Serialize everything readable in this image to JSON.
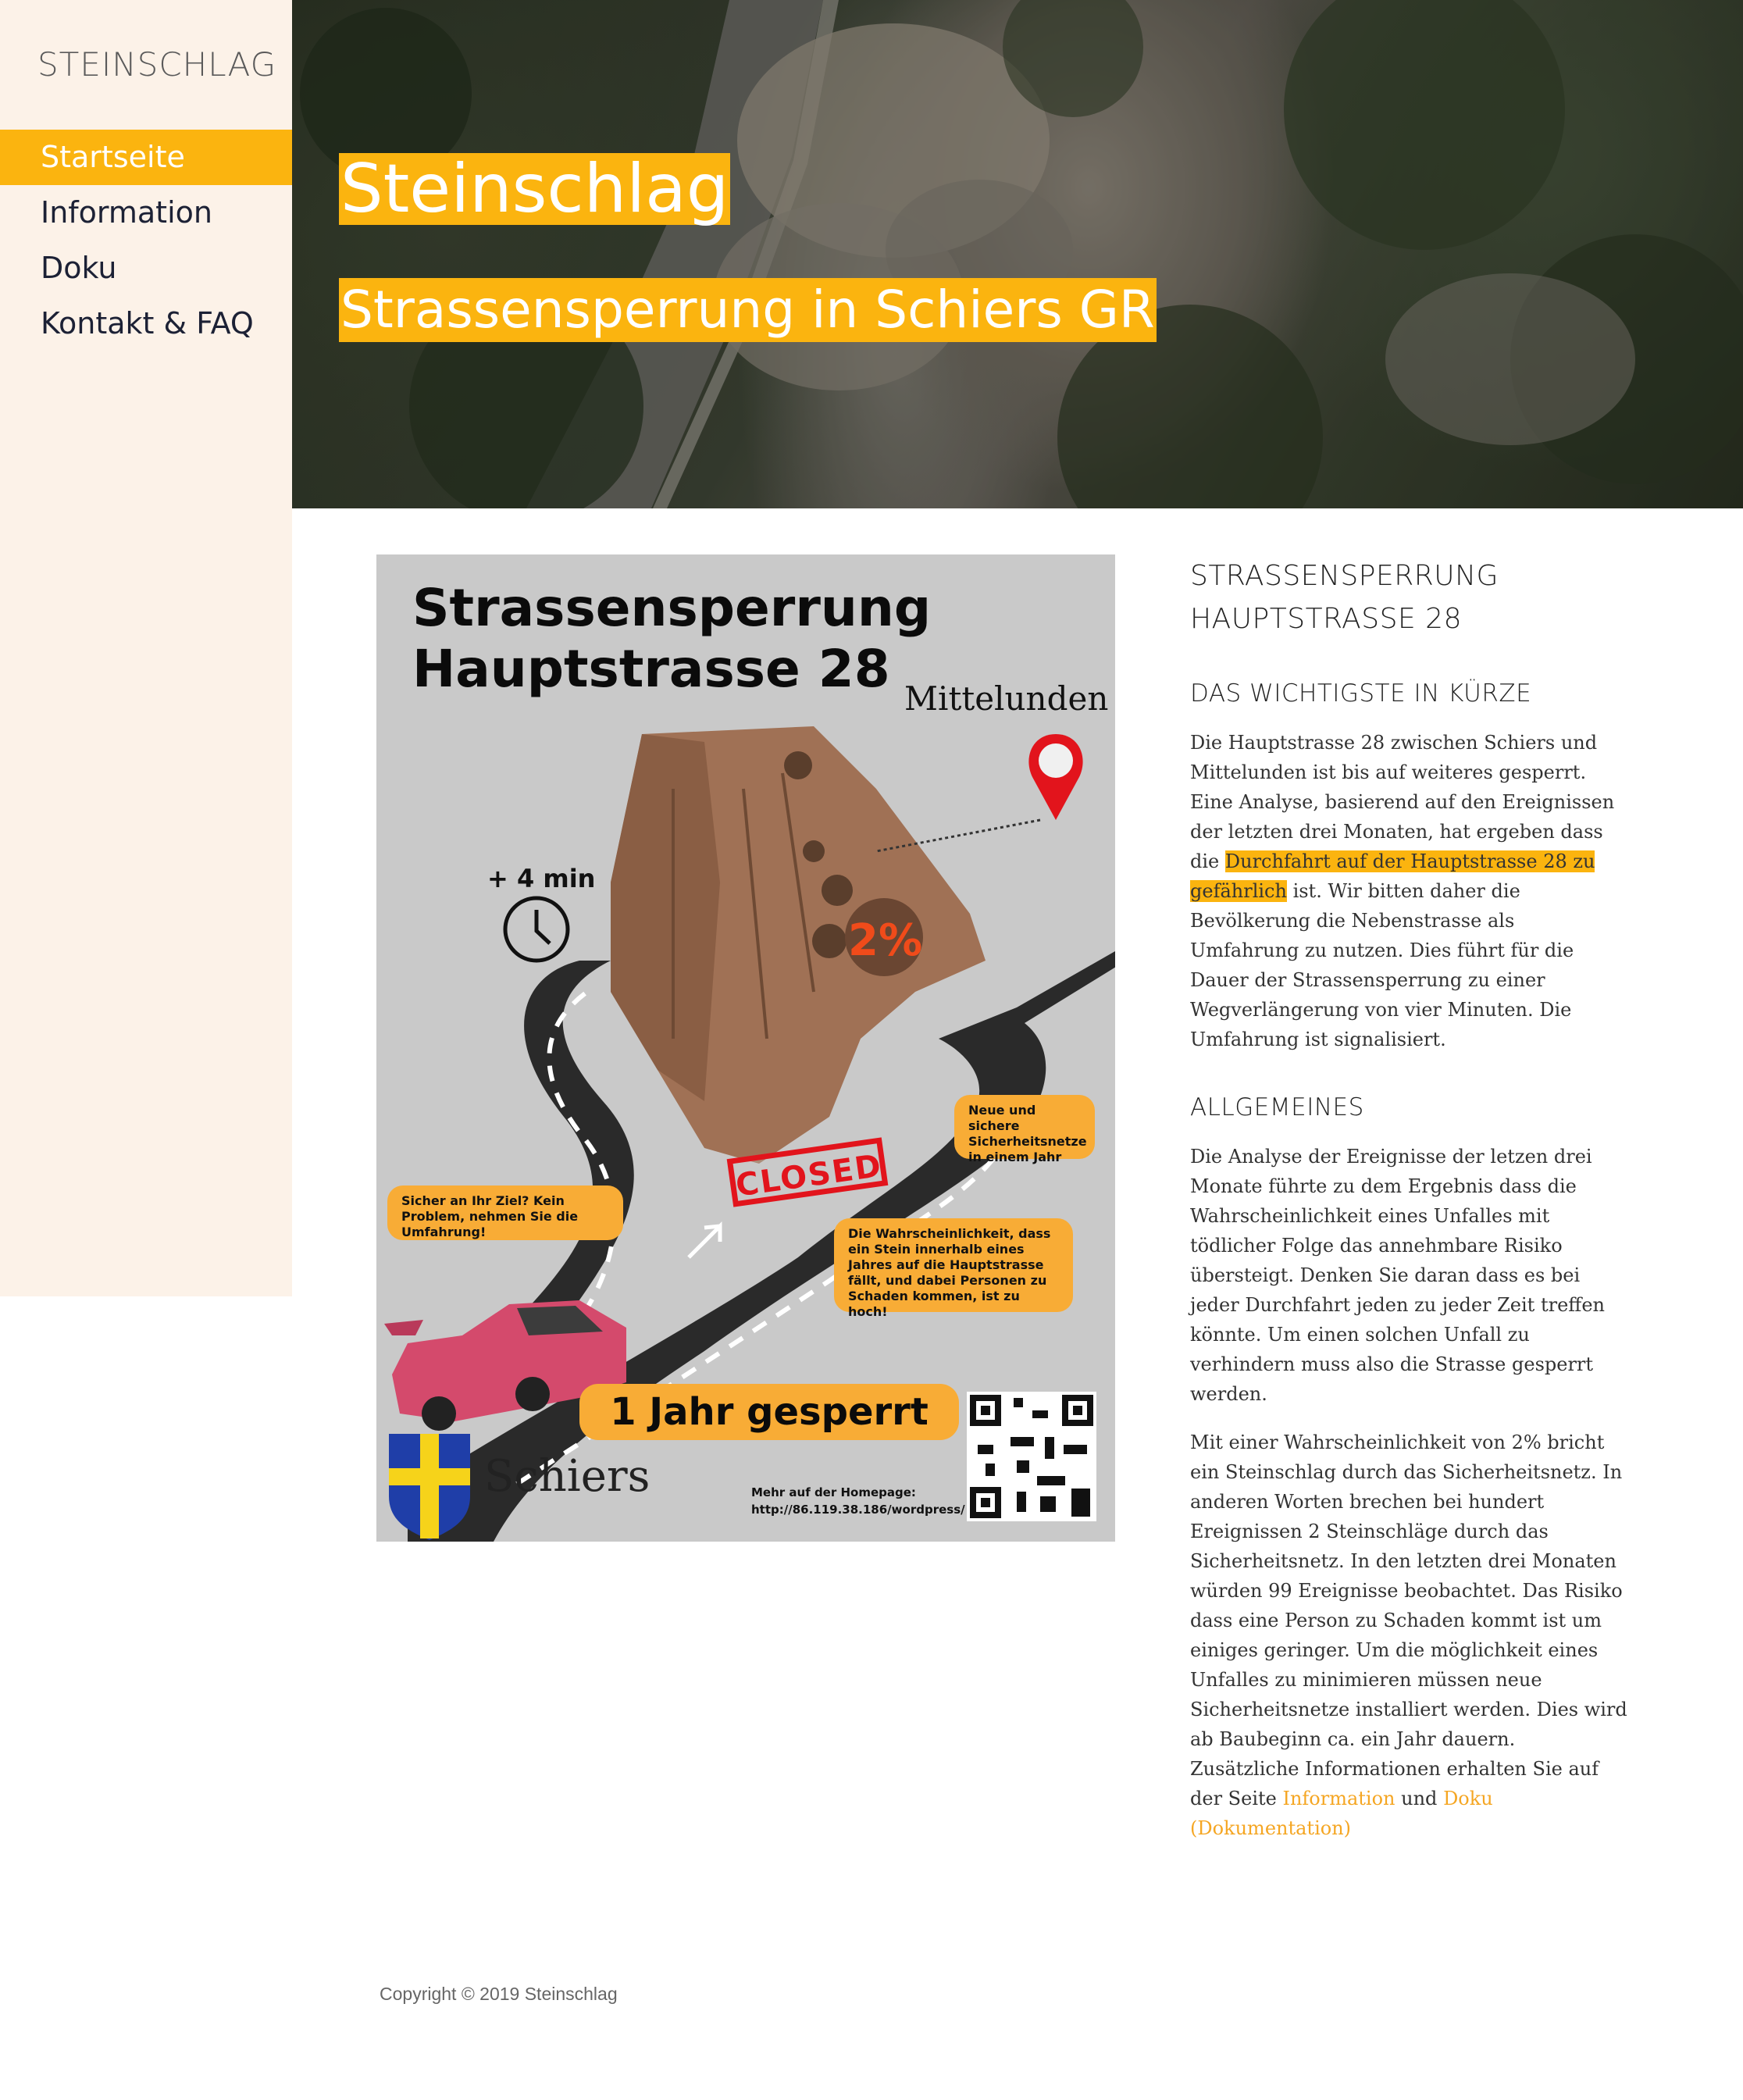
{
  "site": {
    "title": "STEINSCHLAG"
  },
  "nav": {
    "items": [
      {
        "label": "Startseite",
        "active": true
      },
      {
        "label": "Information",
        "active": false
      },
      {
        "label": "Doku",
        "active": false
      },
      {
        "label": "Kontakt & FAQ",
        "active": false
      }
    ]
  },
  "hero": {
    "title": "Steinschlag",
    "subtitle": "Strassensperrung in Schiers GR"
  },
  "poster": {
    "title_line1": "Strassensperrung",
    "title_line2": "Hauptstrasse 28",
    "town": "Mittelunden",
    "time": "+ 4 min",
    "percent": "2%",
    "bubble_nets": "Neue und sichere Sicherheitsnetze in einem Jahr",
    "closed": "CLOSED",
    "bubble_detour": "Sicher an Ihr Ziel? Kein Problem, nehmen Sie die Umfahrung!",
    "bubble_probability": "Die Wahrscheinlichkeit, dass ein Stein innerhalb eines Jahres auf die Hauptstrasse fällt, und dabei Personen zu Schaden kommen, ist zu hoch!",
    "banner": "1 Jahr gesperrt",
    "municipality": "Schiers",
    "homepage_line1": "Mehr auf der Homepage:",
    "homepage_line2": "http://86.119.38.186/wordpress/"
  },
  "content": {
    "heading_line1": "STRASSENSPERRUNG",
    "heading_line2": "HAUPTSTRASSE 28",
    "section1_title": "DAS WICHTIGSTE IN KÜRZE",
    "section1_text_before": "Die Hauptstrasse 28 zwischen Schiers und Mittelunden ist bis auf weiteres gesperrt. Eine Analyse, basierend auf den Ereignissen der letzten drei Monaten, hat ergeben dass die ",
    "section1_highlight": "Durchfahrt auf der Hauptstrasse 28 zu gefährlich",
    "section1_text_after": " ist. Wir bitten daher die Bevölkerung die Nebenstrasse als Umfahrung zu nutzen. Dies führt für die Dauer der Strassensperrung zu einer Wegverlängerung von vier Minuten. Die Umfahrung ist signalisiert.",
    "section2_title": "ALLGEMEINES",
    "section2_para1": "Die Analyse der Ereignisse der letzen drei Monate führte zu dem Ergebnis dass die Wahrscheinlichkeit eines Unfalles mit tödlicher Folge das annehmbare Risiko übersteigt. Denken Sie daran dass es bei jeder Durchfahrt jeden zu jeder Zeit treffen könnte. Um einen solchen Unfall zu verhindern muss also die Strasse gesperrt werden.",
    "section2_para2": "Mit einer Wahrscheinlichkeit von 2% bricht ein Steinschlag durch das Sicherheitsnetz. In anderen Worten brechen bei hundert Ereignissen 2 Steinschläge durch das Sicherheitsnetz. In den letzten drei Monaten würden 99 Ereignisse beobachtet. Das Risiko dass eine Person zu Schaden kommt ist um einiges geringer. Um die möglichkeit eines Unfalles zu minimieren müssen neue Sicherheitsnetze installiert werden. Dies wird ab Baubeginn ca. ein Jahr dauern. Zusätzliche Informationen erhalten Sie auf der Seite ",
    "link_information": "Information",
    "link_and": " und ",
    "link_doku": "Doku (Dokumentation)"
  },
  "footer": {
    "text": "Copyright © 2019 Steinschlag"
  },
  "colors": {
    "accent": "#fbb40f",
    "sidebar_bg": "#fcf2e8",
    "poster_orange": "#f8ac36"
  }
}
